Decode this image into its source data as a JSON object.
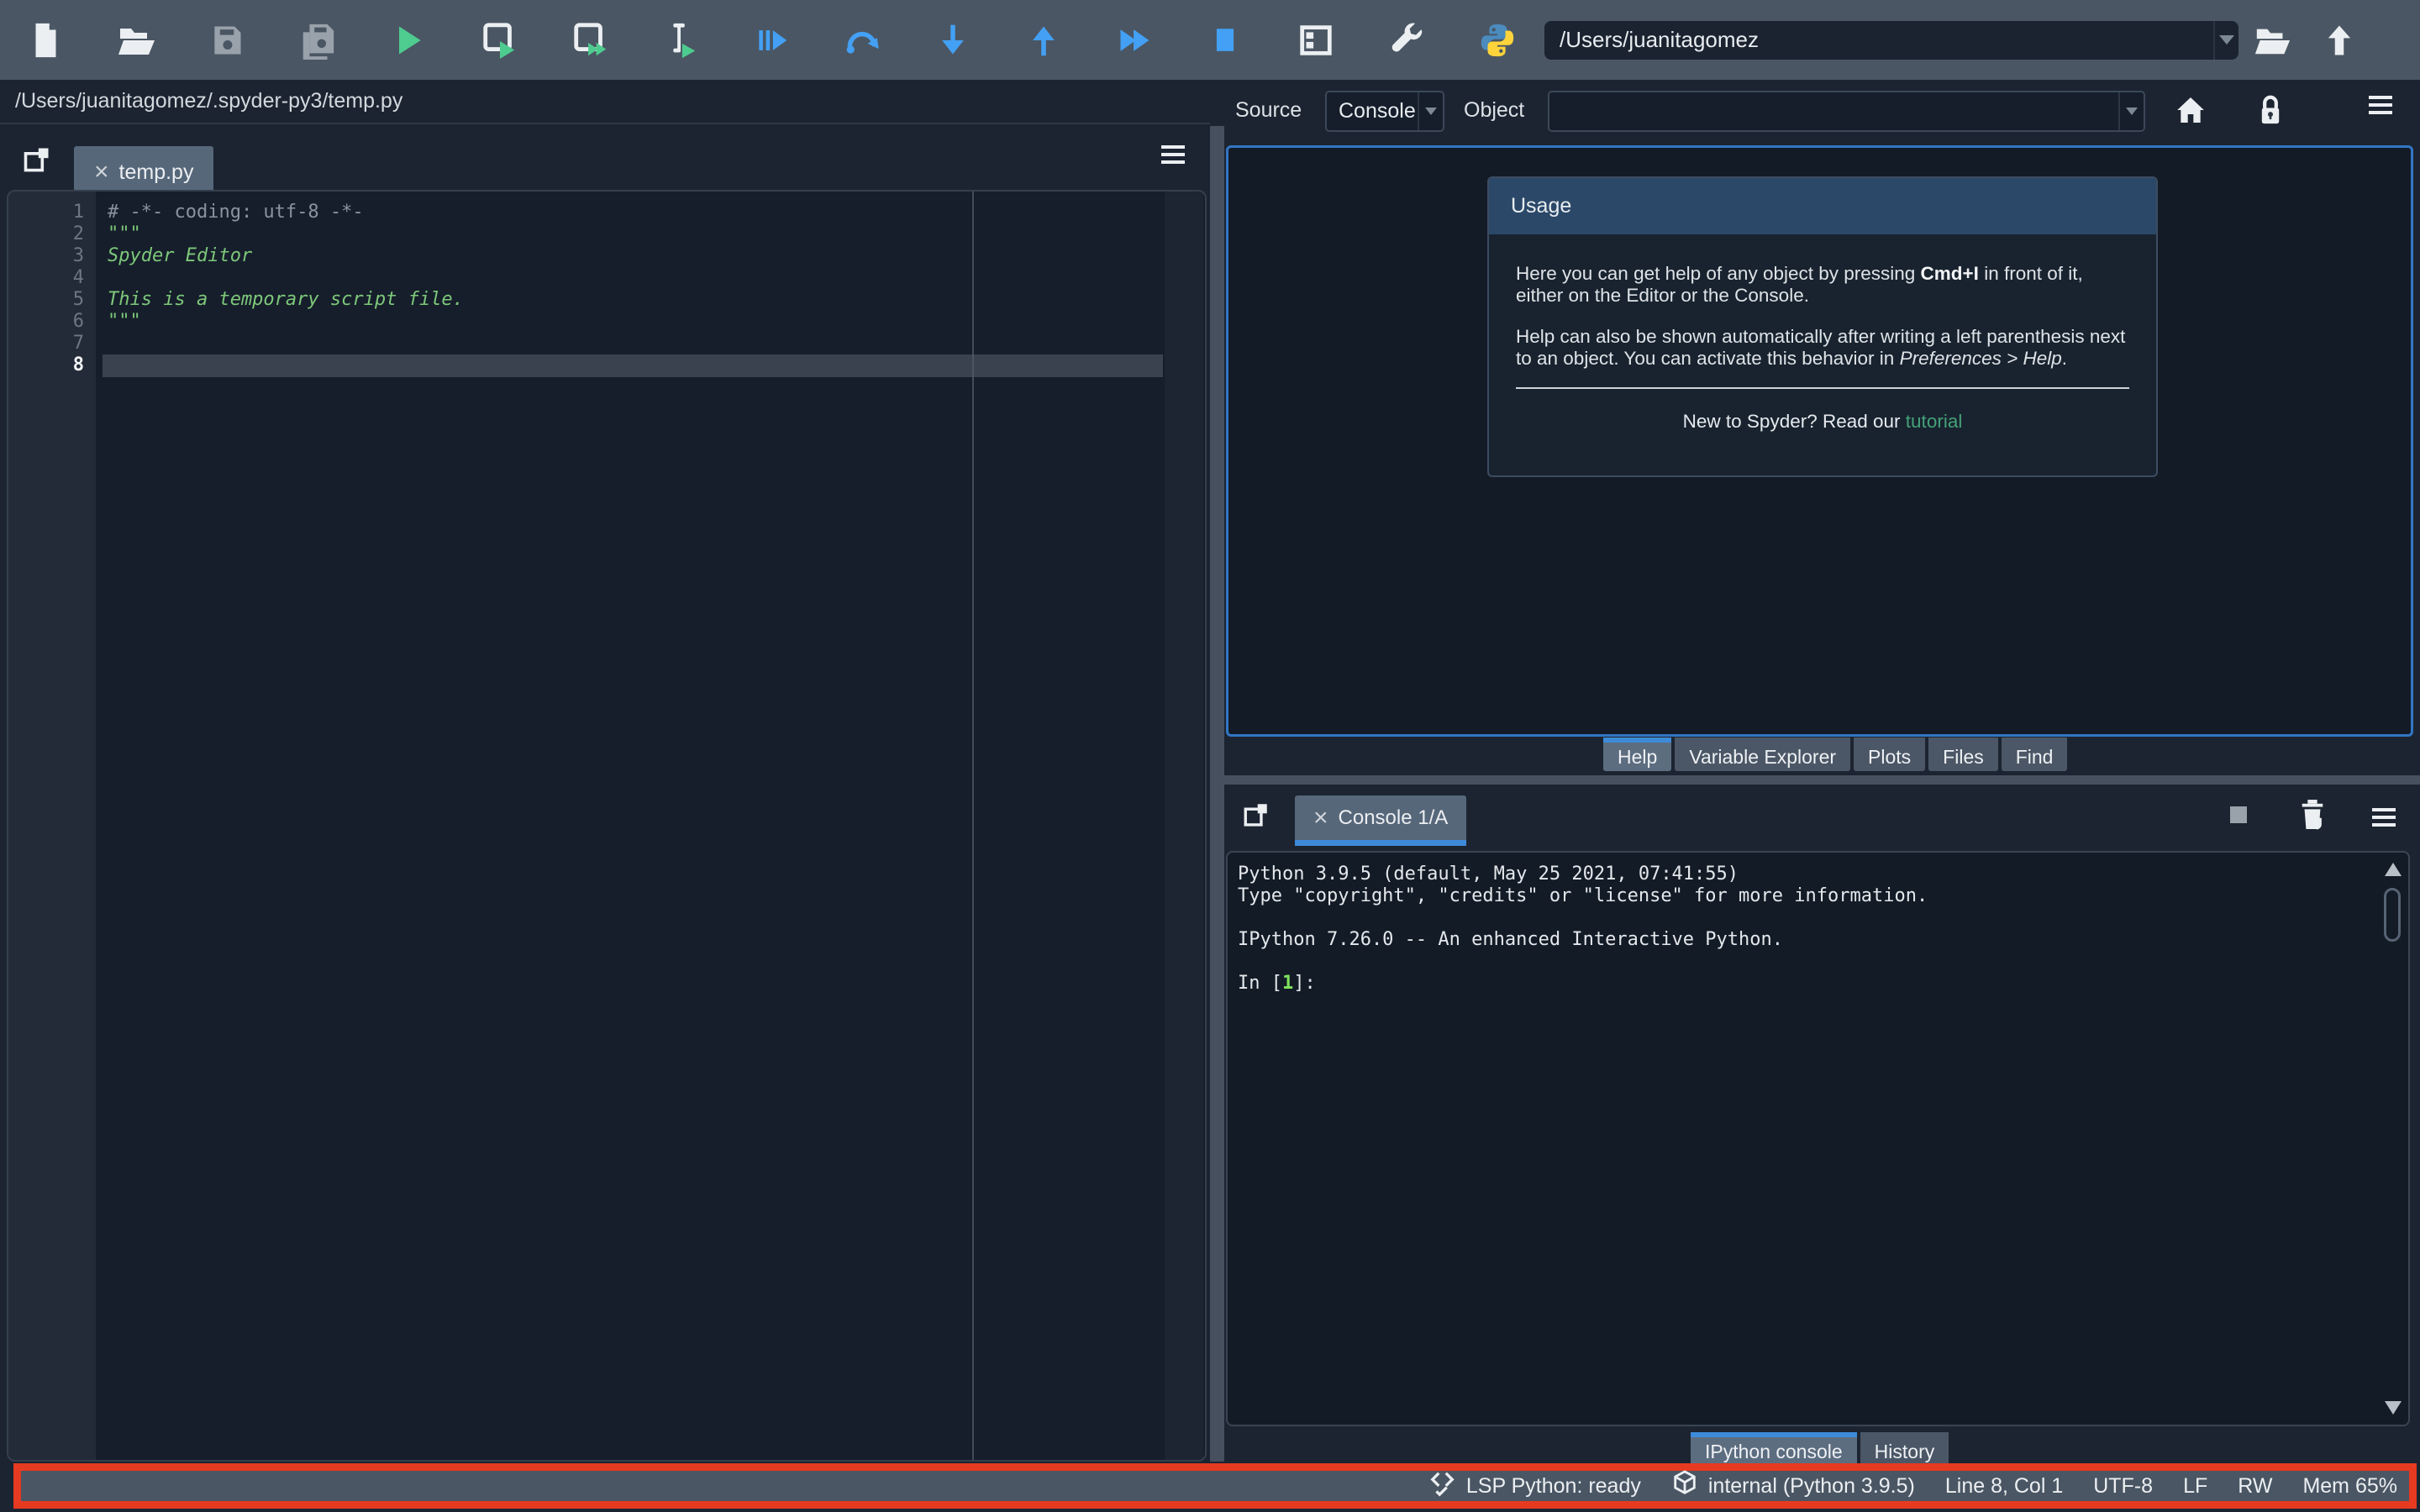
{
  "colors": {
    "accent_blue": "#3d8bd8",
    "focus_border_blue": "#3276c4",
    "run_green": "#4ecb8f",
    "debug_blue": "#43a0f4",
    "link_green": "#45a178",
    "code_string_green": "#7dc87a",
    "comment_gray": "#8a939e",
    "prompt_green": "#23c93f",
    "highlight_red": "#e63a21",
    "toolbar_gray": "#4a5663",
    "python_blue": "#4b8bbe",
    "python_yellow": "#ffd43b"
  },
  "toolbar": {
    "icons": [
      "new-file",
      "open-file",
      "save",
      "save-all",
      "run",
      "run-cell",
      "run-cell-and-advance",
      "run-selection",
      "debug",
      "step-over",
      "step-into",
      "step-out",
      "continue-execution",
      "stop",
      "maximize-pane",
      "tools",
      "python-interpreter",
      "dropdown-arrow",
      "browse-working-directory",
      "parent-directory"
    ],
    "path_value": "/Users/juanitagomez"
  },
  "editor": {
    "filepath": "/Users/juanitagomez/.spyder-py3/temp.py",
    "tab_label": "temp.py",
    "close_glyph": "×",
    "current_line": 8,
    "lines": [
      {
        "num": "1",
        "text": "# -*- coding: utf-8 -*-"
      },
      {
        "num": "2",
        "text": "\"\"\""
      },
      {
        "num": "3",
        "text": "Spyder Editor"
      },
      {
        "num": "4",
        "text": ""
      },
      {
        "num": "5",
        "text": "This is a temporary script file."
      },
      {
        "num": "6",
        "text": "\"\"\""
      },
      {
        "num": "7",
        "text": ""
      },
      {
        "num": "8",
        "text": ""
      }
    ]
  },
  "help": {
    "source_label": "Source",
    "source_value": "Console",
    "object_label": "Object",
    "object_value": "",
    "usage_title": "Usage",
    "p1_a": "Here you can get help of any object by pressing ",
    "p1_b": "Cmd+I",
    "p1_c": " in front of it, either on the Editor or the Console.",
    "p2_a": "Help can also be shown automatically after writing a left parenthesis next to an object. You can activate this behavior in ",
    "p2_b": "Preferences > Help",
    "p2_c": ".",
    "footer_text": "New to Spyder? Read our ",
    "footer_link": "tutorial",
    "tabs": [
      {
        "label": "Help"
      },
      {
        "label": "Variable Explorer"
      },
      {
        "label": "Plots"
      },
      {
        "label": "Files"
      },
      {
        "label": "Find"
      }
    ]
  },
  "console": {
    "tab_label": "Console 1/A",
    "close_glyph": "×",
    "lines": [
      "Python 3.9.5 (default, May 25 2021, 07:41:55)",
      "Type \"copyright\", \"credits\" or \"license\" for more information.",
      "",
      "IPython 7.26.0 -- An enhanced Interactive Python.",
      ""
    ],
    "prompt_pre": "In [",
    "prompt_num": "1",
    "prompt_post": "]:",
    "tabs": [
      {
        "label": "IPython console"
      },
      {
        "label": "History"
      }
    ]
  },
  "statusbar": {
    "lsp": "LSP Python: ready",
    "interpreter": "internal (Python 3.9.5)",
    "cursor": "Line 8, Col 1",
    "encoding": "UTF-8",
    "eol": "LF",
    "permissions": "RW",
    "memory": "Mem 65%"
  }
}
